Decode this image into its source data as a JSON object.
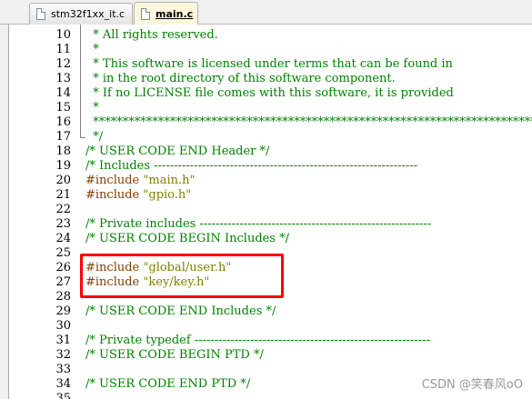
{
  "tabs": [
    {
      "label": "stm32f1xx_it.c",
      "active": false
    },
    {
      "label": "main.c",
      "active": true
    }
  ],
  "editor": {
    "lines": [
      {
        "num": "10",
        "segs": [
          {
            "c": "cm",
            "t": "  * All rights reserved."
          }
        ]
      },
      {
        "num": "11",
        "segs": [
          {
            "c": "cm",
            "t": "  *"
          }
        ]
      },
      {
        "num": "12",
        "segs": [
          {
            "c": "cm",
            "t": "  * This software is licensed under terms that can be found in"
          }
        ]
      },
      {
        "num": "13",
        "segs": [
          {
            "c": "cm",
            "t": "  * in the root directory of this software component."
          }
        ]
      },
      {
        "num": "14",
        "segs": [
          {
            "c": "cm",
            "t": "  * If no LICENSE file comes with this software, it is provided"
          }
        ]
      },
      {
        "num": "15",
        "segs": [
          {
            "c": "cm",
            "t": "  *"
          }
        ]
      },
      {
        "num": "16",
        "segs": [
          {
            "c": "cm",
            "t": "  ******************************************************************************"
          }
        ]
      },
      {
        "num": "17",
        "segs": [
          {
            "c": "cm",
            "t": "  */"
          }
        ]
      },
      {
        "num": "18",
        "segs": [
          {
            "c": "cm",
            "t": "/* USER CODE END Header */"
          }
        ]
      },
      {
        "num": "19",
        "segs": [
          {
            "c": "cm",
            "t": "/* Includes ------------------------------------------------------------------"
          }
        ]
      },
      {
        "num": "20",
        "segs": [
          {
            "c": "pp",
            "t": "#include "
          },
          {
            "c": "st",
            "t": "\"main.h\""
          }
        ]
      },
      {
        "num": "21",
        "segs": [
          {
            "c": "pp",
            "t": "#include "
          },
          {
            "c": "st",
            "t": "\"gpio.h\""
          }
        ]
      },
      {
        "num": "22",
        "segs": []
      },
      {
        "num": "23",
        "segs": [
          {
            "c": "cm",
            "t": "/* Private includes ----------------------------------------------------------"
          }
        ]
      },
      {
        "num": "24",
        "segs": [
          {
            "c": "cm",
            "t": "/* USER CODE BEGIN Includes */"
          }
        ]
      },
      {
        "num": "25",
        "segs": []
      },
      {
        "num": "26",
        "segs": [
          {
            "c": "pp",
            "t": "#include "
          },
          {
            "c": "st",
            "t": "\"global/user.h\""
          }
        ]
      },
      {
        "num": "27",
        "segs": [
          {
            "c": "pp",
            "t": "#include "
          },
          {
            "c": "st",
            "t": "\"key/key.h\""
          }
        ]
      },
      {
        "num": "28",
        "segs": []
      },
      {
        "num": "29",
        "segs": [
          {
            "c": "cm",
            "t": "/* USER CODE END Includes */"
          }
        ]
      },
      {
        "num": "30",
        "segs": []
      },
      {
        "num": "31",
        "segs": [
          {
            "c": "cm",
            "t": "/* Private typedef -----------------------------------------------------------"
          }
        ]
      },
      {
        "num": "32",
        "segs": [
          {
            "c": "cm",
            "t": "/* USER CODE BEGIN PTD */"
          }
        ]
      },
      {
        "num": "33",
        "segs": []
      },
      {
        "num": "34",
        "segs": [
          {
            "c": "cm",
            "t": "/* USER CODE END PTD */"
          }
        ]
      },
      {
        "num": "35",
        "segs": []
      }
    ]
  },
  "watermark": "CSDN @笑春风oO"
}
